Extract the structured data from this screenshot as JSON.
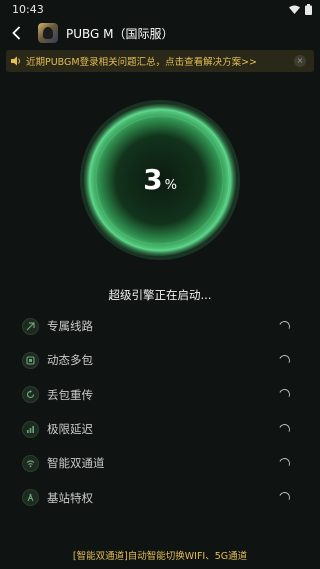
{
  "status_bar": {
    "time": "10:43"
  },
  "header": {
    "title": "PUBG M（国际服）"
  },
  "notice": {
    "text": "近期PUBGM登录相关问题汇总，点击查看解决方案>>"
  },
  "progress": {
    "value": "3",
    "unit": "%"
  },
  "status_text": "超级引擎正在启动...",
  "features": [
    {
      "label": "专属线路",
      "icon": "route-icon"
    },
    {
      "label": "动态多包",
      "icon": "multi-packet-icon"
    },
    {
      "label": "丢包重传",
      "icon": "retransmit-icon"
    },
    {
      "label": "极限延迟",
      "icon": "latency-icon"
    },
    {
      "label": "智能双通道",
      "icon": "dual-channel-icon"
    },
    {
      "label": "基站特权",
      "icon": "base-station-icon"
    }
  ],
  "footer": "[智能双通道]自动智能切换WIFI、5G通道",
  "colors": {
    "accent_gold": "#e4be56",
    "orb_green": "#4fd07a",
    "background": "#0f1412"
  }
}
